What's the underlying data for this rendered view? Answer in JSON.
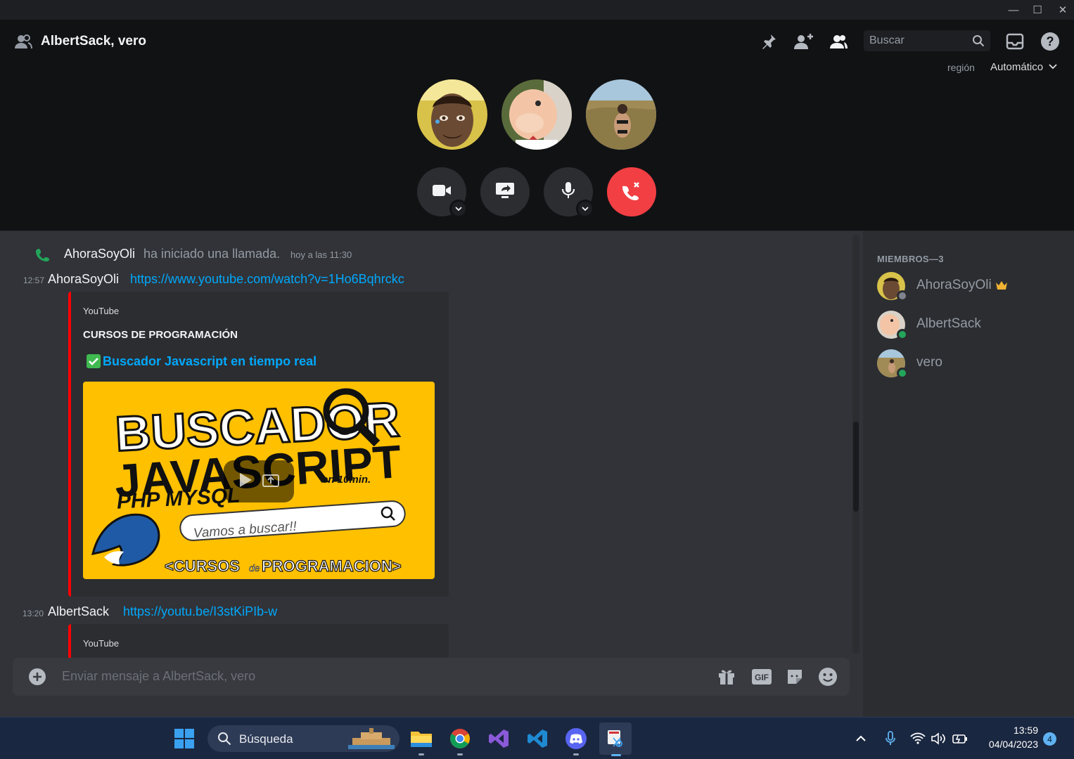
{
  "window": {
    "minimize_icon": "minimize-icon",
    "maximize_icon": "maximize-icon",
    "close_icon": "close-icon"
  },
  "header": {
    "title": "AlbertSack, vero",
    "search_placeholder": "Buscar",
    "icons": [
      "group-dm-icon",
      "pin-icon",
      "add-friend-icon",
      "members-icon",
      "search-icon",
      "inbox-icon",
      "help-icon"
    ]
  },
  "call": {
    "region_label": "región",
    "region_value": "Automático",
    "participants": [
      "AhoraSoyOli",
      "AlbertSack",
      "vero"
    ],
    "controls": [
      "camera-icon",
      "screen-share-icon",
      "microphone-icon",
      "hang-up-icon"
    ],
    "colors": {
      "hangup": "#f23f43"
    }
  },
  "chat": {
    "system": {
      "user": "AhoraSoyOli",
      "text": "ha iniciado una llamada.",
      "time": "hoy a las 11:30"
    },
    "messages": [
      {
        "time": "12:57",
        "author": "AhoraSoyOli",
        "link": "https://www.youtube.com/watch?v=1Ho6Bqhrckc",
        "embed": {
          "provider": "YouTube",
          "author": "CURSOS DE PROGRAMACIÓN",
          "title": "Buscador Javascript en tiempo real",
          "thumbnail": {
            "line1": "BUSCADOR",
            "line2": "JAVASCRIPT",
            "line3": "PHP MYSQL",
            "badge": "en 10min.",
            "search_text": "Vamos a buscar!!",
            "footer_a": "<CURSOS",
            "footer_b": "de",
            "footer_c": "PROGRAMACION>"
          }
        }
      },
      {
        "time": "13:20",
        "author": "AlbertSack",
        "link": "https://youtu.be/I3stKiPIb-w",
        "embed": {
          "provider": "YouTube"
        }
      }
    ],
    "composer_placeholder": "Enviar mensaje a AlbertSack, vero"
  },
  "members": {
    "heading": "MIEMBROS—3",
    "list": [
      {
        "name": "AhoraSoyOli",
        "status": "offline",
        "owner": true
      },
      {
        "name": "AlbertSack",
        "status": "online",
        "owner": false
      },
      {
        "name": "vero",
        "status": "online",
        "owner": false
      }
    ],
    "colors": {
      "online": "#23a55a",
      "offline": "#80848e",
      "crown": "#f0b232"
    }
  },
  "taskbar": {
    "search_label": "Búsqueda",
    "apps": [
      "windows-start-icon",
      "file-explorer-icon",
      "chrome-icon",
      "visual-studio-icon",
      "vscode-icon",
      "discord-icon",
      "snipping-tool-icon"
    ],
    "time": "13:59",
    "date": "04/04/2023",
    "notification_count": "4"
  }
}
